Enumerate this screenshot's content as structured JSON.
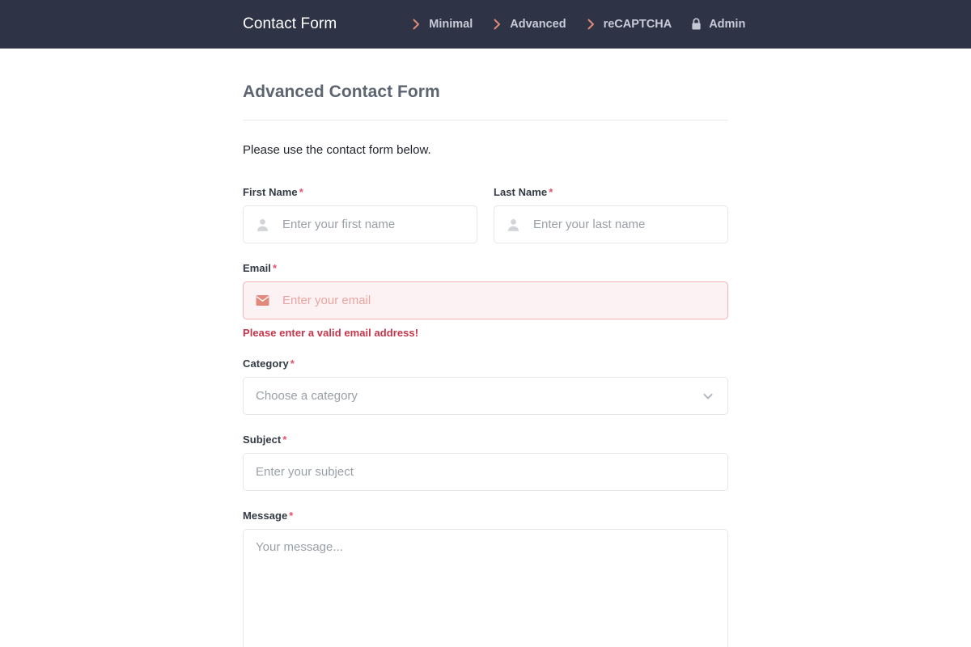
{
  "header": {
    "brand": "Contact Form",
    "nav_items": [
      {
        "label": "Minimal",
        "icon": "chevron-right-icon"
      },
      {
        "label": "Advanced",
        "icon": "chevron-right-icon"
      },
      {
        "label": "reCAPTCHA",
        "icon": "chevron-right-icon"
      },
      {
        "label": "Admin",
        "icon": "lock-icon"
      }
    ],
    "bg_color": "#2e3445",
    "chevron_color": "#e0897c",
    "link_color": "#c7ccd8"
  },
  "page": {
    "title": "Advanced Contact Form",
    "intro": "Please use the contact form below."
  },
  "form": {
    "required_marker": "*",
    "first_name": {
      "label": "First Name",
      "placeholder": "Enter your first name",
      "value": "",
      "icon": "user-icon"
    },
    "last_name": {
      "label": "Last Name",
      "placeholder": "Enter your last name",
      "value": "",
      "icon": "user-icon"
    },
    "email": {
      "label": "Email",
      "placeholder": "Enter your email",
      "value": "",
      "icon": "envelope-icon",
      "error": "Please enter a valid email address!",
      "error_color": "#c8344a",
      "error_bg": "#fdf2f3",
      "error_border": "#f0b4b4"
    },
    "category": {
      "label": "Category",
      "placeholder": "Choose a category",
      "value": "",
      "icon": "chevron-down-icon"
    },
    "subject": {
      "label": "Subject",
      "placeholder": "Enter your subject",
      "value": ""
    },
    "message": {
      "label": "Message",
      "placeholder": "Your message...",
      "value": ""
    }
  }
}
